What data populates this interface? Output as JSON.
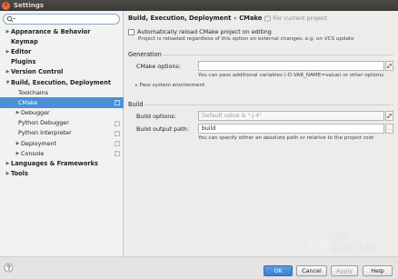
{
  "window": {
    "title": "Settings"
  },
  "search": {
    "placeholder": ""
  },
  "tree": [
    {
      "label": "Appearance & Behavior",
      "arrow": "▶",
      "bold": true
    },
    {
      "label": "Keymap",
      "arrow": "",
      "bold": true
    },
    {
      "label": "Editor",
      "arrow": "▶",
      "bold": true
    },
    {
      "label": "Plugins",
      "arrow": "",
      "bold": true
    },
    {
      "label": "Version Control",
      "arrow": "▶",
      "bold": true
    },
    {
      "label": "Build, Execution, Deployment",
      "arrow": "▼",
      "bold": true
    },
    {
      "label": "Toolchains",
      "arrow": "",
      "bold": false
    },
    {
      "label": "CMake",
      "arrow": "",
      "bold": false,
      "selected": true,
      "copy": true
    },
    {
      "label": "Debugger",
      "arrow": "▶",
      "bold": false
    },
    {
      "label": "Python Debugger",
      "arrow": "",
      "bold": false,
      "copy": true
    },
    {
      "label": "Python Interpreter",
      "arrow": "",
      "bold": false,
      "copy": true
    },
    {
      "label": "Deployment",
      "arrow": "▶",
      "bold": false,
      "copy": true
    },
    {
      "label": "Console",
      "arrow": "▶",
      "bold": false,
      "copy": true
    },
    {
      "label": "Languages & Frameworks",
      "arrow": "▶",
      "bold": true
    },
    {
      "label": "Tools",
      "arrow": "▶",
      "bold": true
    }
  ],
  "breadcrumb": {
    "parent": "Build, Execution, Deployment",
    "separator": "›",
    "current": "CMake",
    "note": "For current project"
  },
  "auto_reload": {
    "label": "Automatically reload CMake project on editing",
    "hint": "Project is reloaded regardless of this option on external changes, e.g. on VCS update"
  },
  "generation": {
    "section": "Generation",
    "cmake_options_label": "CMake options:",
    "cmake_options_value": "",
    "cmake_options_hint": "You can pass additional variables (-D VAR_NAME=value) or other options.",
    "pass_env": "Pass system environment",
    "pass_env_arrow": "▸"
  },
  "build": {
    "section": "Build",
    "build_options_label": "Build options:",
    "build_options_placeholder": "Default value is \"-j 4\"",
    "output_path_label": "Build output path:",
    "output_path_value": "build",
    "output_path_hint": "You can specify either an absolute path or relative to the project root"
  },
  "buttons": {
    "ok": "OK",
    "cancel": "Cancel",
    "apply": "Apply",
    "help": "Help"
  },
  "watermark": {
    "text": "知乎 @goldqiu"
  },
  "colors": {
    "selection": "#4a90d9",
    "primary_button": "#3d7fcc",
    "close_button": "#e9683c"
  }
}
